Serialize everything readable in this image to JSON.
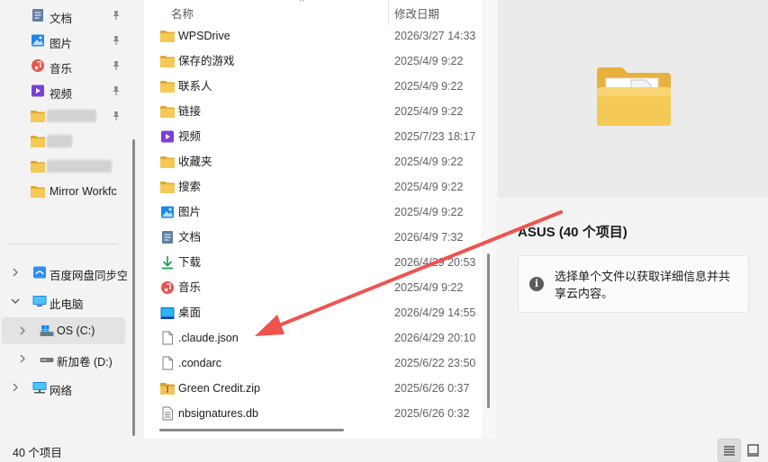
{
  "nav": {
    "quick_access": [
      {
        "label": "文档",
        "icon": "document-icon",
        "pinned": true
      },
      {
        "label": "图片",
        "icon": "pictures-icon",
        "pinned": true
      },
      {
        "label": "音乐",
        "icon": "music-icon",
        "pinned": true
      },
      {
        "label": "视频",
        "icon": "videos-icon",
        "pinned": true
      },
      {
        "label": "",
        "icon": "folder-icon",
        "pinned": true
      },
      {
        "label": "",
        "icon": "folder-icon",
        "pinned": false
      },
      {
        "label": "",
        "icon": "folder-icon",
        "pinned": false
      },
      {
        "label": "Mirror Workfc",
        "icon": "folder-icon",
        "pinned": false
      }
    ],
    "tree": [
      {
        "label": "百度网盘同步空",
        "icon": "baidu-sync-icon",
        "expandable": true
      },
      {
        "label": "此电脑",
        "icon": "this-pc-icon",
        "expanded": true
      },
      {
        "label": "OS (C:)",
        "icon": "os-drive-icon",
        "selected": true
      },
      {
        "label": "新加卷 (D:)",
        "icon": "drive-icon"
      },
      {
        "label": "网络",
        "icon": "network-icon",
        "expandable": true
      }
    ]
  },
  "list": {
    "columns": {
      "name": "名称",
      "modified": "修改日期"
    },
    "files": [
      {
        "name": "WPSDrive",
        "date": "2026/3/27 14:33",
        "icon": "folder-icon"
      },
      {
        "name": "保存的游戏",
        "date": "2025/4/9 9:22",
        "icon": "folder-icon"
      },
      {
        "name": "联系人",
        "date": "2025/4/9 9:22",
        "icon": "folder-icon"
      },
      {
        "name": "链接",
        "date": "2025/4/9 9:22",
        "icon": "folder-icon"
      },
      {
        "name": "视频",
        "date": "2025/7/23 18:17",
        "icon": "videos-icon"
      },
      {
        "name": "收藏夹",
        "date": "2025/4/9 9:22",
        "icon": "folder-icon"
      },
      {
        "name": "搜索",
        "date": "2025/4/9 9:22",
        "icon": "folder-icon"
      },
      {
        "name": "图片",
        "date": "2025/4/9 9:22",
        "icon": "pictures-icon"
      },
      {
        "name": "文档",
        "date": "2026/4/9 7:32",
        "icon": "document-icon"
      },
      {
        "name": "下载",
        "date": "2026/4/29 20:53",
        "icon": "download-icon"
      },
      {
        "name": "音乐",
        "date": "2025/4/9 9:22",
        "icon": "music-icon"
      },
      {
        "name": "桌面",
        "date": "2026/4/29 14:55",
        "icon": "desktop-icon"
      },
      {
        "name": ".claude.json",
        "date": "2026/4/29 20:10",
        "icon": "file-icon"
      },
      {
        "name": ".condarc",
        "date": "2025/6/22 23:50",
        "icon": "file-icon"
      },
      {
        "name": "Green Credit.zip",
        "date": "2025/6/26 0:37",
        "icon": "zip-icon"
      },
      {
        "name": "nbsignatures.db",
        "date": "2025/6/26 0:32",
        "icon": "db-file-icon"
      }
    ]
  },
  "details": {
    "title": "ASUS (40 个项目)",
    "info": "选择单个文件以获取详细信息并共享云内容。"
  },
  "status": {
    "item_count": "40 个项目"
  },
  "colors": {
    "folder": "#f2c55c",
    "folder_dark": "#e0a82e",
    "annotation_arrow": "#ef5350"
  }
}
